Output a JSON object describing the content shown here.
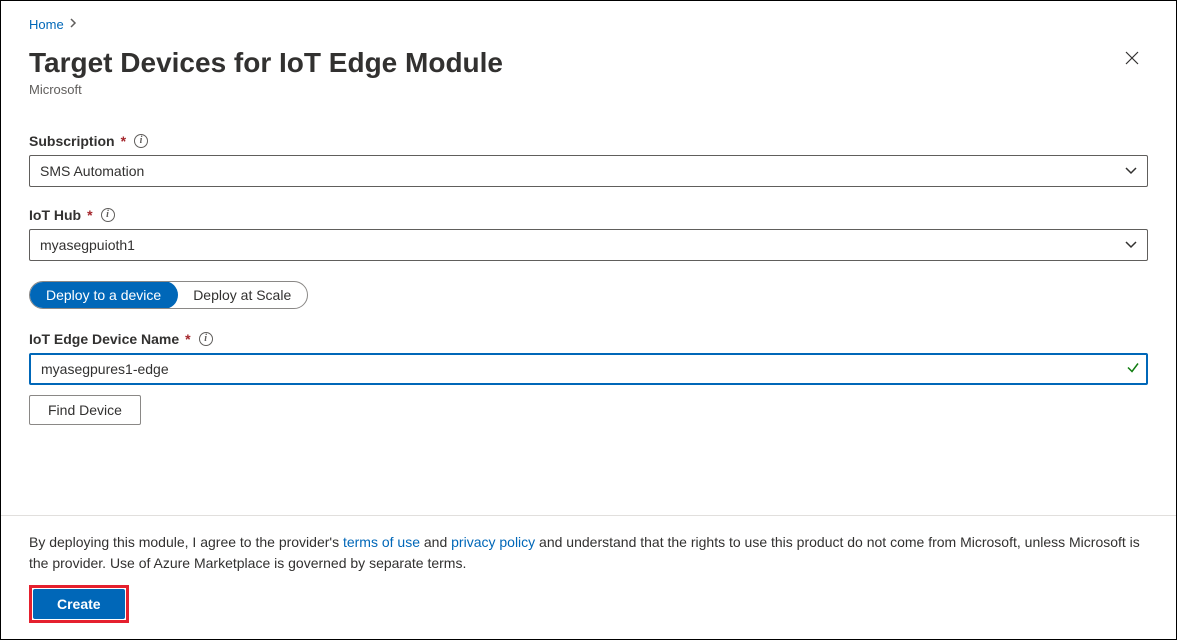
{
  "breadcrumb": {
    "home": "Home"
  },
  "header": {
    "title": "Target Devices for IoT Edge Module",
    "subtitle": "Microsoft"
  },
  "fields": {
    "subscription": {
      "label": "Subscription",
      "value": "SMS Automation"
    },
    "iothub": {
      "label": "IoT Hub",
      "value": "myasegpuioth1"
    },
    "devicename": {
      "label": "IoT Edge Device Name",
      "value": "myasegpures1-edge"
    }
  },
  "toggle": {
    "device": "Deploy to a device",
    "scale": "Deploy at Scale"
  },
  "buttons": {
    "find_device": "Find Device",
    "create": "Create"
  },
  "footer": {
    "prefix": "By deploying this module, I agree to the provider's ",
    "terms": "terms of use",
    "and": " and ",
    "privacy": "privacy policy",
    "suffix": " and understand that the rights to use this product do not come from Microsoft, unless Microsoft is the provider. Use of Azure Marketplace is governed by separate terms."
  }
}
